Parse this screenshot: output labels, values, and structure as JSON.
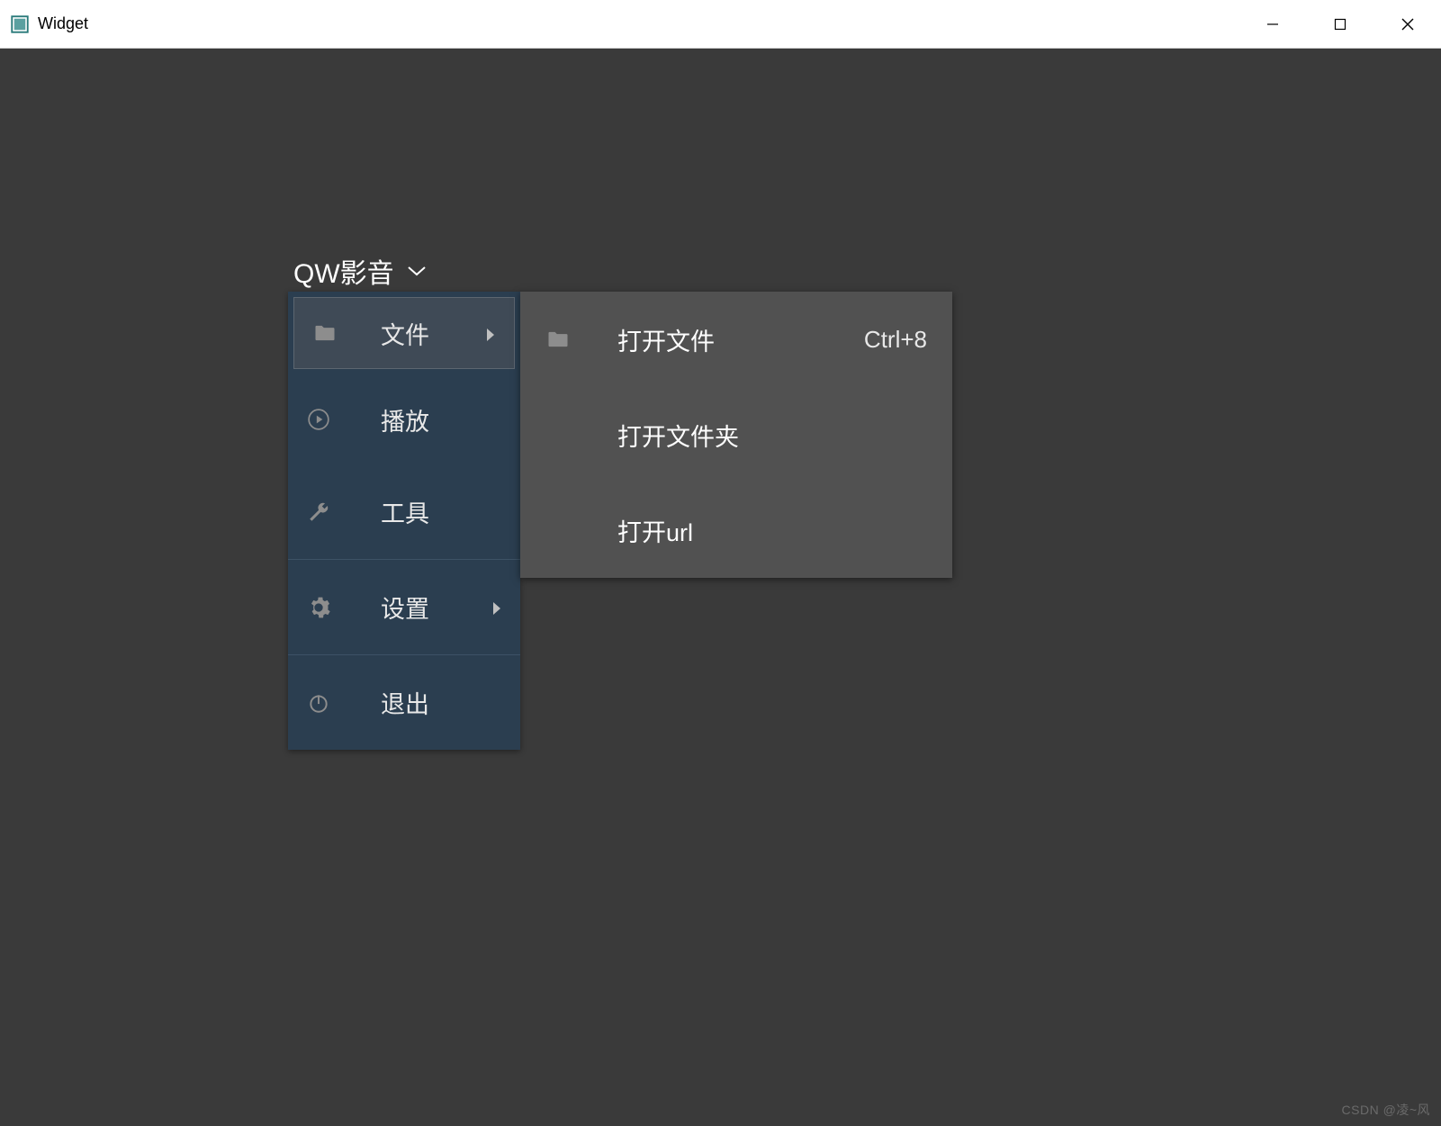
{
  "window": {
    "title": "Widget"
  },
  "header": {
    "brand": "QW影音"
  },
  "menu": {
    "items": [
      {
        "label": "文件",
        "has_sub": true,
        "icon": "folder"
      },
      {
        "label": "播放",
        "has_sub": false,
        "icon": "play"
      },
      {
        "label": "工具",
        "has_sub": false,
        "icon": "wrench"
      },
      {
        "label": "设置",
        "has_sub": true,
        "icon": "gear"
      },
      {
        "label": "退出",
        "has_sub": false,
        "icon": "power"
      }
    ]
  },
  "submenu": {
    "items": [
      {
        "label": "打开文件",
        "shortcut": "Ctrl+8",
        "icon": "folder"
      },
      {
        "label": "打开文件夹",
        "shortcut": "",
        "icon": ""
      },
      {
        "label": "打开url",
        "shortcut": "",
        "icon": ""
      }
    ]
  },
  "watermark": "CSDN @凌~风"
}
